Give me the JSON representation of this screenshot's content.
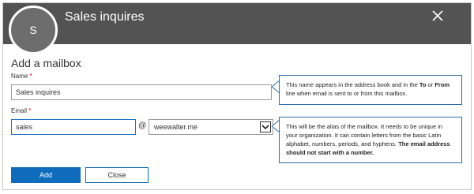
{
  "header": {
    "avatar_initial": "S",
    "title": "Sales inquires"
  },
  "form": {
    "section_title": "Add a mailbox",
    "name_label": "Name",
    "name_required_mark": "*",
    "name_value": "Sales inquires",
    "email_label": "Email",
    "email_required_mark": "*",
    "email_value": "sales",
    "at_symbol": "@",
    "domain_selected": "weewalter.me"
  },
  "callouts": {
    "name_help_1": "This name appears in the address book and in the ",
    "name_help_to": "To",
    "name_help_2": " or ",
    "name_help_from": "From",
    "name_help_3": " line when email is sent to or from this mailbox.",
    "email_help_1": "This will be the alias of the mailbox. It needs to be unique in your organization. It can contain letters from the basic Latin alphabet, numbers, periods, and hyphens. ",
    "email_help_bold": "The email address should not start with a number."
  },
  "buttons": {
    "add_label": "Add",
    "close_label": "Close"
  },
  "colors": {
    "header_bg": "#535353",
    "accent": "#0f6cbd",
    "callout_border": "#2b6cb0",
    "required": "#cc0000"
  },
  "icons": {
    "close": "close-icon",
    "dropdown": "chevron-down-icon"
  }
}
